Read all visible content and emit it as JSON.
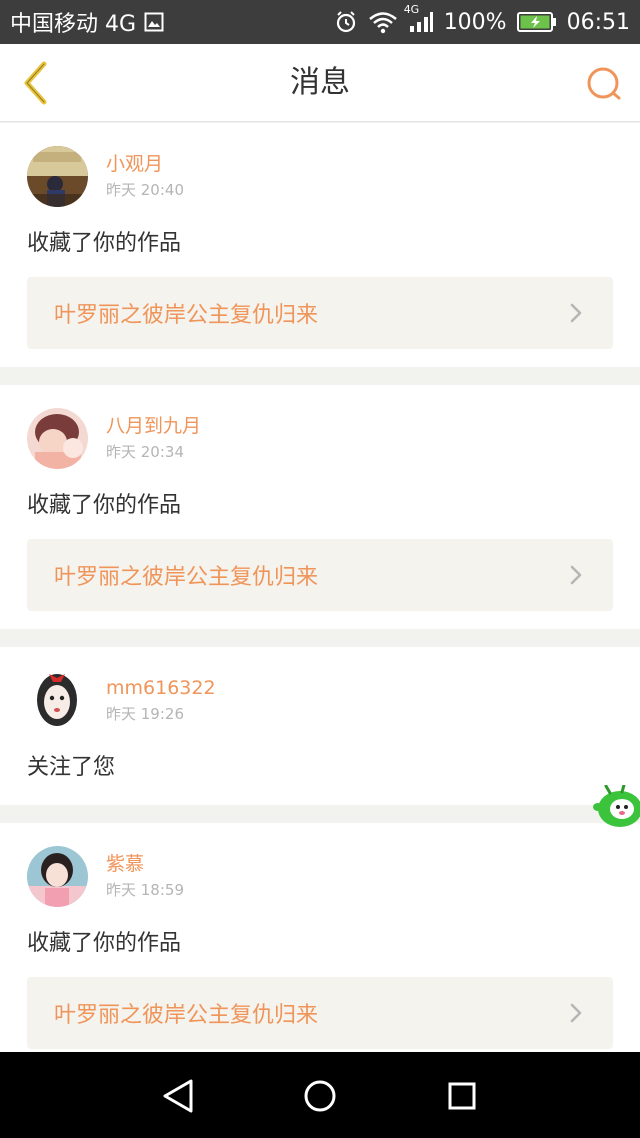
{
  "status_bar": {
    "carrier": "中国移动 4G",
    "network_badge": "4G",
    "battery": "100%",
    "time": "06:51"
  },
  "header": {
    "title": "消息",
    "back_icon": "chevron-left-icon",
    "search_icon": "search-icon"
  },
  "messages": [
    {
      "username": "小观月",
      "time": "昨天 20:40",
      "action": "收藏了你的作品",
      "work_title": "叶罗丽之彼岸公主复仇归来"
    },
    {
      "username": "八月到九月",
      "time": "昨天 20:34",
      "action": "收藏了你的作品",
      "work_title": "叶罗丽之彼岸公主复仇归来"
    },
    {
      "username": "mm616322",
      "time": "昨天 19:26",
      "action": "关注了您"
    },
    {
      "username": "紫慕",
      "time": "昨天 18:59",
      "action": "收藏了你的作品",
      "work_title": "叶罗丽之彼岸公主复仇归来"
    }
  ],
  "colors": {
    "accent": "#f0955a",
    "back_icon": "#e7c43c",
    "header_bg": "#ffffff",
    "statusbar_bg": "#3d3d3d",
    "navbar_bg": "#000000"
  }
}
